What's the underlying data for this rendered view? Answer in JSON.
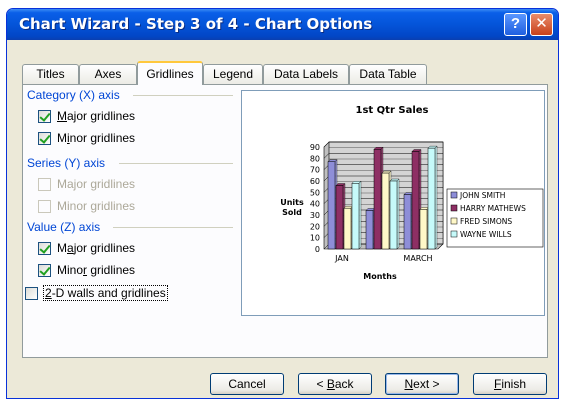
{
  "window": {
    "title": "Chart Wizard - Step 3 of 4 - Chart Options",
    "help_glyph": "?",
    "close_glyph": "✕"
  },
  "tabs": [
    {
      "label": "Titles",
      "active": false
    },
    {
      "label": "Axes",
      "active": false
    },
    {
      "label": "Gridlines",
      "active": true
    },
    {
      "label": "Legend",
      "active": false
    },
    {
      "label": "Data Labels",
      "active": false
    },
    {
      "label": "Data Table",
      "active": false
    }
  ],
  "groups": {
    "category": {
      "label": "Category (X) axis",
      "major": {
        "pre": "",
        "key": "M",
        "post": "ajor gridlines",
        "checked": true,
        "enabled": true
      },
      "minor": {
        "pre": "M",
        "key": "i",
        "post": "nor gridlines",
        "checked": true,
        "enabled": true
      }
    },
    "series": {
      "label": "Series (Y) axis",
      "major": {
        "text": "Major gridlines",
        "checked": false,
        "enabled": false
      },
      "minor": {
        "text": "Minor gridlines",
        "checked": false,
        "enabled": false
      }
    },
    "value": {
      "label": "Value (Z) axis",
      "major": {
        "pre": "M",
        "key": "a",
        "post": "jor gridlines",
        "checked": true,
        "enabled": true
      },
      "minor": {
        "pre": "Mino",
        "key": "r",
        "post": " gridlines",
        "checked": true,
        "enabled": true
      }
    },
    "walls": {
      "key": "2",
      "post": "-D walls and gridlines",
      "checked": false,
      "enabled": true
    }
  },
  "buttons": {
    "cancel": "Cancel",
    "back": {
      "pre": "< ",
      "key": "B",
      "post": "ack"
    },
    "next": {
      "key": "N",
      "post": "ext >"
    },
    "finish": {
      "key": "F",
      "post": "inish"
    }
  },
  "colors": {
    "john": "#8e8ed8",
    "harry": "#8e2f64",
    "fred": "#fff8c8",
    "wayne": "#c6fafa"
  },
  "chart_data": {
    "type": "bar",
    "title": "1st Qtr Sales",
    "xlabel": "Months",
    "ylabel_lines": [
      "Units",
      "Sold"
    ],
    "categories": [
      "JAN",
      "",
      "MARCH"
    ],
    "tick_labels": [
      "90",
      "80",
      "70",
      "60",
      "50",
      "40",
      "30",
      "20",
      "10",
      "0"
    ],
    "ylim": [
      0,
      90
    ],
    "series": [
      {
        "name": "JOHN SMITH",
        "values": [
          77,
          34,
          48
        ]
      },
      {
        "name": "HARRY MATHEWS",
        "values": [
          56,
          88,
          86
        ]
      },
      {
        "name": "FRED SIMONS",
        "values": [
          36,
          67,
          35
        ]
      },
      {
        "name": "WAYNE WILLS",
        "values": [
          58,
          60,
          89
        ]
      }
    ],
    "legend_position": "right"
  }
}
